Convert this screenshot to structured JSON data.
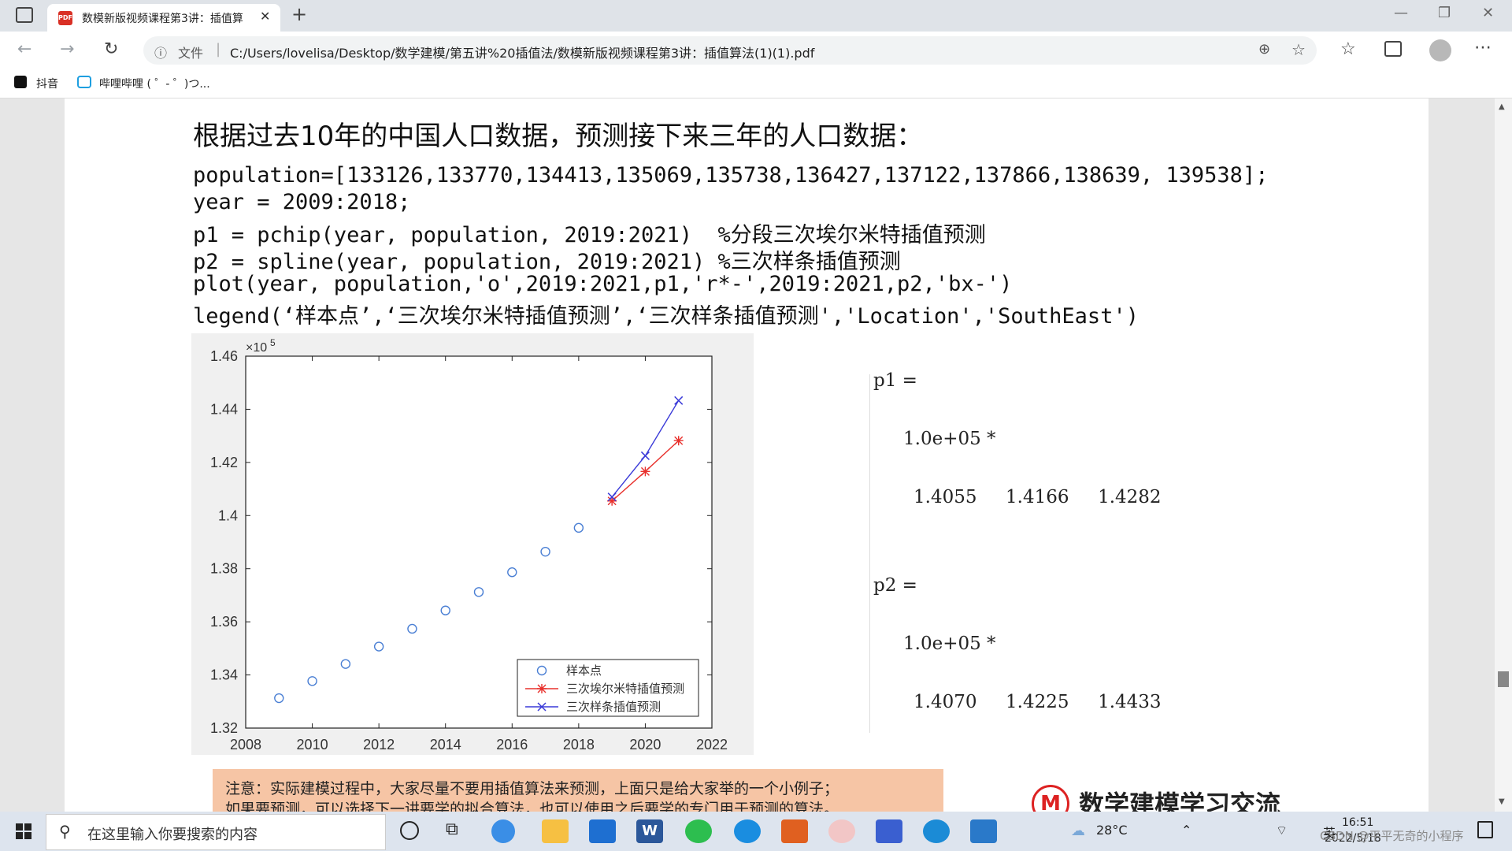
{
  "browser": {
    "tab_title": "数模新版视频课程第3讲：插值算",
    "tab_icon": "PDF",
    "new_tab": "+",
    "address": {
      "info": "ⓘ",
      "file_label": "文件",
      "url": "C:/Users/lovelisa/Desktop/数学建模/第五讲%20插值法/数模新版视频课程第3讲：插值算法(1)(1).pdf"
    },
    "bookmarks": [
      {
        "label": "抖音"
      },
      {
        "label": "哔哩哔哩 ( ゜- ゜)つ..."
      }
    ]
  },
  "document": {
    "heading": "根据过去10年的中国人口数据，预测接下来三年的人口数据：",
    "code_lines": [
      "population=[133126,133770,134413,135069,135738,136427,137122,137866,138639, 139538];",
      "year = 2009:2018;",
      "p1 = pchip(year, population, 2019:2021)  %分段三次埃尔米特插值预测",
      "p2 = spline(year, population, 2019:2021) %三次样条插值预测",
      "plot(year, population,'o',2019:2021,p1,'r*-',2019:2021,p2,'bx-')",
      "legend(‘样本点’,‘三次埃尔米特插值预测’,‘三次样条插值预测','Location','SouthEast')"
    ],
    "output": {
      "p1_label": "p1 =",
      "p1_scale": "1.0e+05 *",
      "p1_values": "1.4055     1.4166     1.4282",
      "p2_label": "p2 =",
      "p2_scale": "1.0e+05 *",
      "p2_values": "1.4070     1.4225     1.4433"
    },
    "note_line1": "注意：实际建模过程中，大家尽量不要用插值算法来预测，上面只是给大家举的一个小例子；",
    "note_line2": "如果要预测，可以选择下一讲要学的拟合算法，也可以使用之后要学的专门用于预测的算法。",
    "logo_text": "数学建模学习交流"
  },
  "chart_data": {
    "type": "line",
    "exponent_label": "×10",
    "exponent_power": "5",
    "xlim": [
      2008,
      2022
    ],
    "ylim": [
      1.32,
      1.46
    ],
    "xticks": [
      "2008",
      "2010",
      "2012",
      "2014",
      "2016",
      "2018",
      "2020",
      "2022"
    ],
    "yticks": [
      "1.32",
      "1.34",
      "1.36",
      "1.38",
      "1.4",
      "1.42",
      "1.44",
      "1.46"
    ],
    "series": [
      {
        "name": "样本点",
        "marker": "o",
        "color": "#4a7fd4",
        "line": false,
        "x": [
          2009,
          2010,
          2011,
          2012,
          2013,
          2014,
          2015,
          2016,
          2017,
          2018
        ],
        "y": [
          1.33126,
          1.3377,
          1.34413,
          1.35069,
          1.35738,
          1.36427,
          1.37122,
          1.37866,
          1.38639,
          1.39538
        ]
      },
      {
        "name": "三次埃尔米特插值预测",
        "marker": "*",
        "color": "#e8302c",
        "line": true,
        "x": [
          2019,
          2020,
          2021
        ],
        "y": [
          1.4055,
          1.4166,
          1.4282
        ]
      },
      {
        "name": "三次样条插值预测",
        "marker": "x",
        "color": "#3a3ad8",
        "line": true,
        "x": [
          2019,
          2020,
          2021
        ],
        "y": [
          1.407,
          1.4225,
          1.4433
        ]
      }
    ],
    "legend_position": "bottom-right"
  },
  "taskbar": {
    "search_placeholder": "在这里输入你要搜索的内容",
    "weather": "28°C",
    "ime": "英",
    "time": "16:51",
    "date": "2022/5/18",
    "watermark": "CSDN @平平无奇的小程序"
  }
}
